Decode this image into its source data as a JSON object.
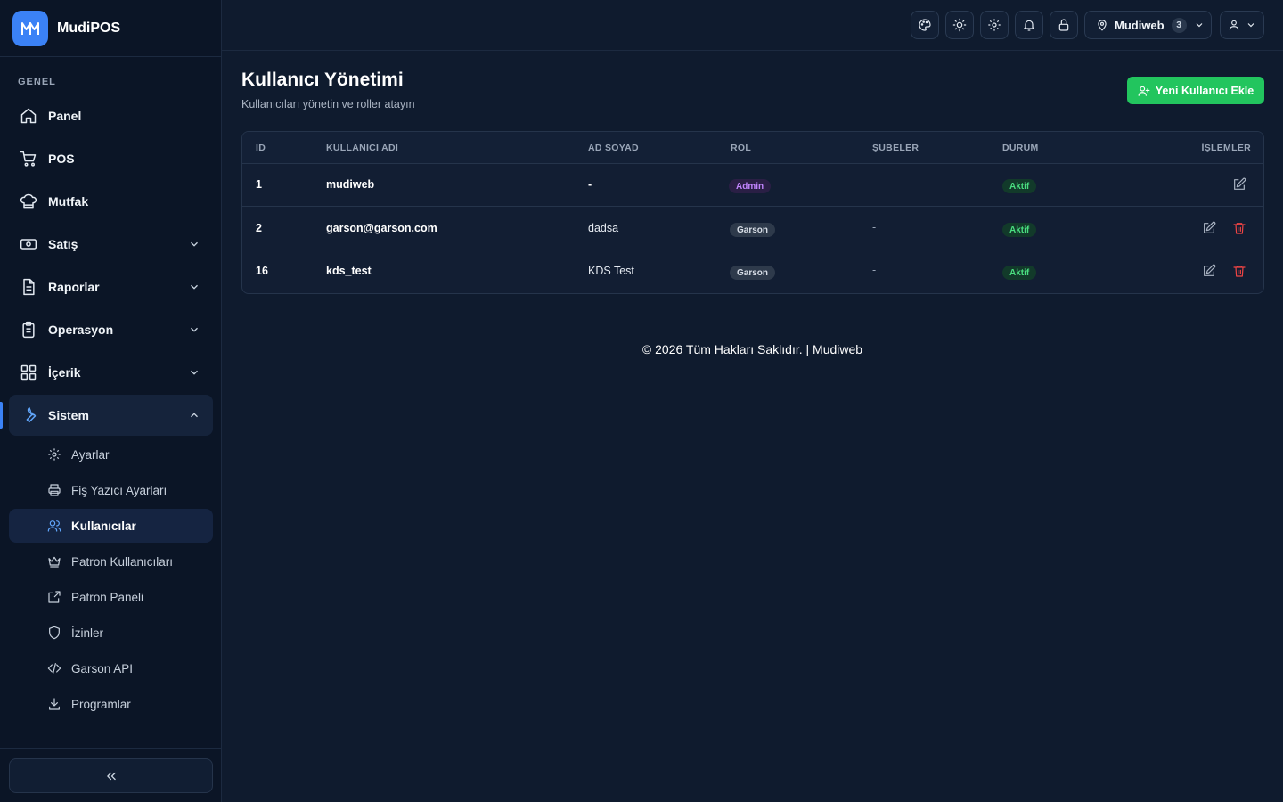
{
  "brand": {
    "logo_text": "M",
    "name": "MudiPOS"
  },
  "sidebar": {
    "section_label": "GENEL",
    "items": [
      {
        "label": "Panel",
        "icon": "home-icon"
      },
      {
        "label": "POS",
        "icon": "cart-icon"
      },
      {
        "label": "Mutfak",
        "icon": "chef-hat-icon"
      },
      {
        "label": "Satış",
        "icon": "cash-icon"
      },
      {
        "label": "Raporlar",
        "icon": "report-icon"
      },
      {
        "label": "Operasyon",
        "icon": "clipboard-icon"
      },
      {
        "label": "İçerik",
        "icon": "grid-icon"
      },
      {
        "label": "Sistem",
        "icon": "wrench-icon"
      }
    ],
    "sub_items": [
      {
        "label": "Ayarlar",
        "icon": "gear-icon"
      },
      {
        "label": "Fiş Yazıcı Ayarları",
        "icon": "printer-icon"
      },
      {
        "label": "Kullanıcılar",
        "icon": "users-icon"
      },
      {
        "label": "Patron Kullanıcıları",
        "icon": "crown-icon"
      },
      {
        "label": "Patron Paneli",
        "icon": "external-link-icon"
      },
      {
        "label": "İzinler",
        "icon": "shield-icon"
      },
      {
        "label": "Garson API",
        "icon": "code-icon"
      },
      {
        "label": "Programlar",
        "icon": "download-icon"
      }
    ],
    "collapse_icon": "chevrons-left-icon"
  },
  "topbar": {
    "branch_label": "Mudiweb",
    "branch_count": "3"
  },
  "page": {
    "title": "Kullanıcı Yönetimi",
    "subtitle": "Kullanıcıları yönetin ve roller atayın",
    "add_button": "Yeni Kullanıcı Ekle"
  },
  "table": {
    "headers": [
      "ID",
      "KULLANICI ADI",
      "AD SOYAD",
      "ROL",
      "ŞUBELER",
      "DURUM",
      "İŞLEMLER"
    ],
    "rows": [
      {
        "id": "1",
        "username": "mudiweb",
        "fullname": "-",
        "role": "Admin",
        "branches": "-",
        "status": "Aktif"
      },
      {
        "id": "2",
        "username": "garson@garson.com",
        "fullname": "dadsa",
        "role": "Garson",
        "branches": "-",
        "status": "Aktif"
      },
      {
        "id": "16",
        "username": "kds_test",
        "fullname": "KDS Test",
        "role": "Garson",
        "branches": "-",
        "status": "Aktif"
      }
    ]
  },
  "footer": {
    "text": "© 2026 Tüm Hakları Saklıdır. | Mudiweb"
  },
  "colors": {
    "accent": "#3b82f6",
    "success": "#22c55e",
    "danger": "#ef4444",
    "admin": "#c084fc"
  }
}
